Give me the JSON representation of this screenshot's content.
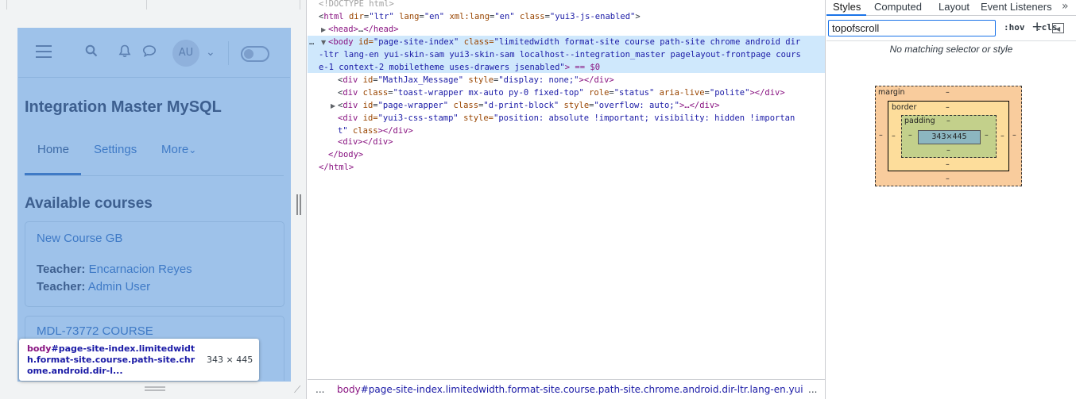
{
  "preview": {
    "app_nav": {
      "user_initials": "AU",
      "chevron": "⌄"
    },
    "site_title": "Integration Master MySQL",
    "tabs": [
      {
        "label": "Home"
      },
      {
        "label": "Settings"
      },
      {
        "label": "More"
      }
    ],
    "more_chevron": "⌄",
    "section_title": "Available courses",
    "courses": [
      {
        "name": "New Course GB",
        "teachers": [
          {
            "role": "Teacher:",
            "name": "Encarnacion Reyes"
          },
          {
            "role": "Teacher:",
            "name": "Admin User"
          }
        ]
      },
      {
        "name": "MDL-73772 COURSE",
        "teachers": []
      }
    ],
    "tooltip": {
      "tag": "body",
      "selector": "#page-site-index.limitedwidth.format-site.course.path-site.chrome.android.dir-l...",
      "dimensions": "343 × 445"
    }
  },
  "elements": {
    "doctype": "<!DOCTYPE html>",
    "html_open": {
      "tag": "html",
      "attrs": [
        {
          "name": "dir",
          "value": "\"ltr\""
        },
        {
          "name": "lang",
          "value": "\"en\""
        },
        {
          "name": "xml:lang",
          "value": "\"en\""
        },
        {
          "name": "class",
          "value": "\"yui3-js-enabled\""
        }
      ]
    },
    "head_collapsed": {
      "open": "<head>",
      "ellipsis": "…",
      "close": "</head>"
    },
    "body_open": {
      "prefix": "…",
      "tag": "<body",
      "id_attr": "id=",
      "id_value": "\"page-site-index\"",
      "class_attr": "class=",
      "class_value_lines": [
        "\"limitedwidth format-site course path-site chrome android dir",
        "-ltr lang-en yui-skin-sam yui3-skin-sam localhost--integration_master pagelayout-frontpage cours",
        "e-1 context-2 mobiletheme uses-drawers jsenabled\""
      ],
      "suffix": "> == $0"
    },
    "children": [
      {
        "tag": "div",
        "attrs": [
          {
            "name": "id",
            "value": "\"MathJax_Message\""
          },
          {
            "name": "style",
            "value": "\"display: none;\""
          }
        ],
        "close": "></div>"
      },
      {
        "tag": "div",
        "attrs": [
          {
            "name": "class",
            "value": "\"toast-wrapper mx-auto py-0 fixed-top\""
          },
          {
            "name": "role",
            "value": "\"status\""
          },
          {
            "name": "aria-live",
            "value": "\"polite\""
          }
        ],
        "close": "></div>"
      },
      {
        "tag": "div",
        "attrs": [
          {
            "name": "id",
            "value": "\"page-wrapper\""
          },
          {
            "name": "class",
            "value": "\"d-print-block\""
          },
          {
            "name": "style",
            "value": "\"overflow: auto;\""
          }
        ],
        "close": ">…</div>"
      }
    ],
    "yui_stamp": {
      "line1_tag": "<div",
      "line1_id_attr": "id=",
      "line1_id_value": "\"yui3-css-stamp\"",
      "line1_style_attr": "style=",
      "line1_style_value": "\"position: absolute !important; visibility: hidden !importan",
      "line2_value": "t\"",
      "line2_class_attr": "class",
      "line2_close": "></div>"
    },
    "empty_div": "<div></div>",
    "body_close": "</body>",
    "html_close": "</html>",
    "breadcrumb": {
      "ellipsis_left": "...",
      "tag": "body",
      "path": "#page-site-index.limitedwidth.format-site.course.path-site.chrome.android.dir-ltr.lang-en.yui-skin-sam.y",
      "ellipsis_right": "..."
    }
  },
  "styles": {
    "tabs": [
      "Styles",
      "Computed",
      "Layout",
      "Event Listeners"
    ],
    "more_tabs": "»",
    "filter_value": "topofscroll",
    "hov_label": ":hov",
    "cls_label": ".cls",
    "add_rule": "+",
    "no_match_text": "No matching selector or style",
    "box_model": {
      "margin_label": "margin",
      "border_label": "border",
      "padding_label": "padding",
      "dash": "–",
      "content_size": "343×445"
    }
  }
}
